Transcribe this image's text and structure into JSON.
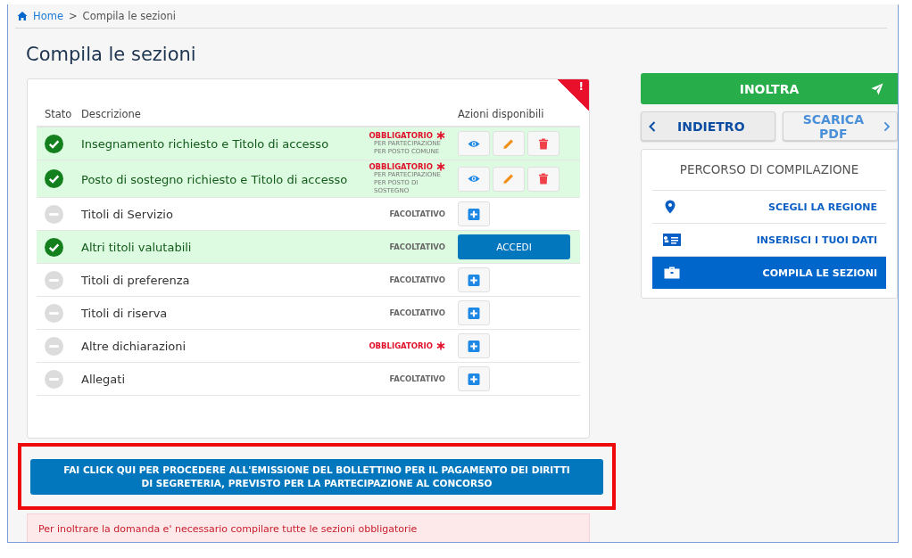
{
  "breadcrumb": {
    "home": "Home",
    "separator": ">",
    "current": "Compila le sezioni"
  },
  "title": "Compila le sezioni",
  "card_flag": "!",
  "table": {
    "columns": [
      "Stato",
      "Descrizione",
      "",
      "Azioni disponibili"
    ],
    "rows": [
      {
        "description": "Insegnamento richiesto e Titolo di accesso",
        "completed": true,
        "required": true,
        "requirement": "OBBLIGATORIO",
        "note": "PER PARTECIPAZIONE PER POSTO COMUNE",
        "kind": "crud"
      },
      {
        "description": "Posto di sostegno richiesto e Titolo di accesso",
        "completed": true,
        "required": true,
        "requirement": "OBBLIGATORIO",
        "note": "PER PARTECIPAZIONE PER POSTO DI SOSTEGNO",
        "kind": "crud"
      },
      {
        "description": "Titoli di Servizio",
        "completed": false,
        "required": false,
        "requirement": "FACOLTATIVO",
        "kind": "add"
      },
      {
        "description": "Altri titoli valutabili",
        "completed": true,
        "required": false,
        "requirement": "FACOLTATIVO",
        "kind": "open",
        "action_label": "ACCEDI"
      },
      {
        "description": "Titoli di preferenza",
        "completed": false,
        "required": false,
        "requirement": "FACOLTATIVO",
        "kind": "add"
      },
      {
        "description": "Titoli di riserva",
        "completed": false,
        "required": false,
        "requirement": "FACOLTATIVO",
        "kind": "add"
      },
      {
        "description": "Altre dichiarazioni",
        "completed": false,
        "required": true,
        "requirement": "OBBLIGATORIO",
        "kind": "add"
      },
      {
        "description": "Allegati",
        "completed": false,
        "required": false,
        "requirement": "FACOLTATIVO",
        "kind": "add"
      }
    ]
  },
  "payment_button": "FAI CLICK QUI PER PROCEDERE ALL'EMISSIONE DEL BOLLETTINO PER IL PAGAMENTO DEI DIRITTI DI SEGRETERIA, PREVISTO PER LA PARTECIPAZIONE AL CONCORSO",
  "alert": "Per inoltrare la domanda e' necessario compilare tutte le sezioni obbligatorie",
  "submit_button": "INOLTRA",
  "back_button": "INDIETRO",
  "pdf_button": "SCARICA PDF",
  "steps_panel": {
    "title": "PERCORSO DI COMPILAZIONE",
    "steps": [
      {
        "label": "SCEGLI LA REGIONE",
        "kind": "pin",
        "selected": false
      },
      {
        "label": "INSERISCI I TUOI DATI",
        "kind": "card",
        "selected": false
      },
      {
        "label": "COMPILA LE SEZIONI",
        "kind": "briefcase",
        "selected": true
      }
    ]
  }
}
